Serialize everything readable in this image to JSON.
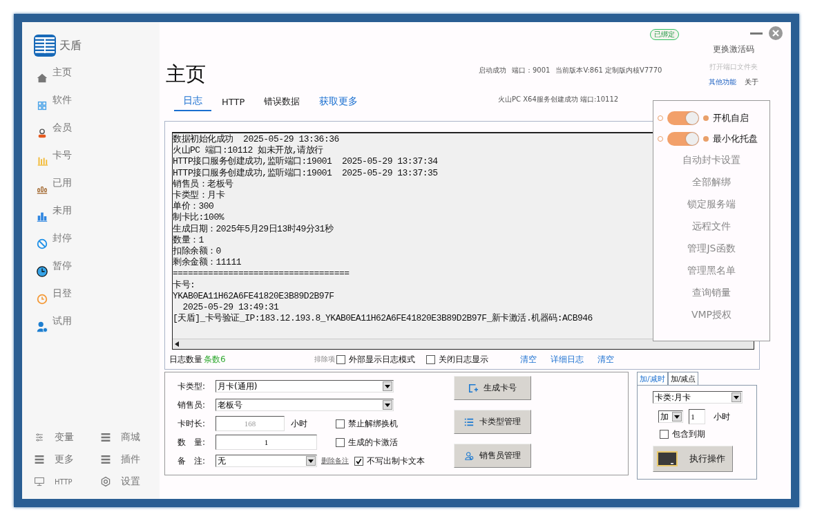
{
  "window": {
    "badge": "已绑定"
  },
  "logo": {
    "name": "天盾"
  },
  "sidebar": {
    "items": [
      {
        "label": "主页",
        "kind": "home"
      },
      {
        "label": "软件",
        "kind": "grid"
      },
      {
        "label": "会员",
        "kind": "user"
      },
      {
        "label": "卡号",
        "kind": "bars"
      },
      {
        "label": "已用",
        "kind": "dots"
      },
      {
        "label": "未用",
        "kind": "chart"
      },
      {
        "label": "封停",
        "kind": "ban"
      },
      {
        "label": "暂停",
        "kind": "pie"
      },
      {
        "label": "日登",
        "kind": "clock"
      },
      {
        "label": "试用",
        "kind": "person"
      }
    ],
    "bottom": [
      {
        "label": "变量",
        "kind": "sliders"
      },
      {
        "label": "商城",
        "kind": "menu"
      },
      {
        "label": "更多",
        "kind": "menu"
      },
      {
        "label": "插件",
        "kind": "menu"
      },
      {
        "label": "HTTP",
        "kind": "monitor"
      },
      {
        "label": "设置",
        "kind": "hexagon"
      }
    ]
  },
  "page_title": "主页",
  "status_line": [
    "启动成功",
    "端口：9001",
    "当前版本V:861 定制版内核V7770"
  ],
  "service_status": "火山PC X64服务创建成功   端口:10112",
  "top_links": [
    {
      "label": "更换激活码",
      "kind": "plain"
    },
    {
      "label": "打开端口文件夹",
      "kind": "faint"
    }
  ],
  "function_links": [
    {
      "label": "其他功能",
      "kind": "link"
    },
    {
      "label": "关于",
      "kind": "bold"
    }
  ],
  "tabs": [
    {
      "label": "日志",
      "kind": "tab",
      "selected": true
    },
    {
      "label": "HTTP",
      "kind": "tab",
      "selected": false
    },
    {
      "label": "错误数据",
      "kind": "tab",
      "selected": false
    },
    {
      "label": "获取更多",
      "kind": "link",
      "selected": false
    }
  ],
  "log_lines": [
    "数据初始化成功  2025-05-29 13:36:36",
    "火山PC 端口:10112 如未开放,请放行",
    "HTTP接口服务创建成功,监听端口:19001  2025-05-29 13:37:34",
    "HTTP接口服务创建成功,监听端口:19001  2025-05-29 13:37:35",
    "销售员：老板号",
    "卡类型：月卡",
    "单价：300",
    "制卡比:100%",
    "生成日期：2025年5月29日13时49分31秒",
    "数量：1",
    "扣除余额：0",
    "剩余金额：11111",
    "===================================",
    "卡号:",
    "YKAB0EA11H62A6FE41820E3B89D2B97F",
    "  2025-05-29 13:49:31",
    "[天盾]_卡号验证_IP:183.12.193.8_YKAB0EA11H62A6FE41820E3B89D2B97F_新卡激活.机器码:ACB946"
  ],
  "log_footer": {
    "count_label": "日志数量",
    "count": "条数6",
    "exclude": "排除项",
    "checks": [
      {
        "label": "外部显示日志模式",
        "checked": false
      },
      {
        "label": "关闭日志显示",
        "checked": false
      }
    ],
    "links": [
      "清空",
      "详细日志",
      "清空"
    ]
  },
  "popup": {
    "toggles": [
      {
        "label": "开机自启",
        "on": true
      },
      {
        "label": "最小化托盘",
        "on": true
      }
    ],
    "items": [
      "自动封卡设置",
      "全部解绑",
      "锁定服务端",
      "远程文件",
      "管理JS函数",
      "管理黑名单",
      "查询销量",
      "VMP授权"
    ]
  },
  "form": {
    "card_type": {
      "label": "卡类型:",
      "value": "月卡(通用)"
    },
    "seller": {
      "label": "销售员:",
      "value": "老板号"
    },
    "duration": {
      "label": "卡时长:",
      "value": "168",
      "unit": "小时",
      "disabled": true
    },
    "quantity": {
      "label": "数　量:",
      "value": "1"
    },
    "note": {
      "label": "备　注:",
      "value": "无",
      "link": "删除备注"
    },
    "checks": [
      {
        "label": "禁止解绑换机",
        "checked": false
      },
      {
        "label": "生成的卡激活",
        "checked": false
      },
      {
        "label": "不写出制卡文本",
        "checked": true
      }
    ],
    "buttons": [
      {
        "label": "生成卡号",
        "kind": "plus"
      },
      {
        "label": "卡类型管理",
        "kind": "list"
      },
      {
        "label": "销售员管理",
        "kind": "users"
      }
    ]
  },
  "adjust": {
    "tabs": [
      {
        "label": "加/减时",
        "selected": true
      },
      {
        "label": "加/减点",
        "selected": false
      }
    ],
    "card_type": "卡类:月卡",
    "op": "加",
    "amount": "1",
    "unit": "小时",
    "include_expired": {
      "label": "包含到期",
      "checked": false
    },
    "button": "执行操作"
  }
}
